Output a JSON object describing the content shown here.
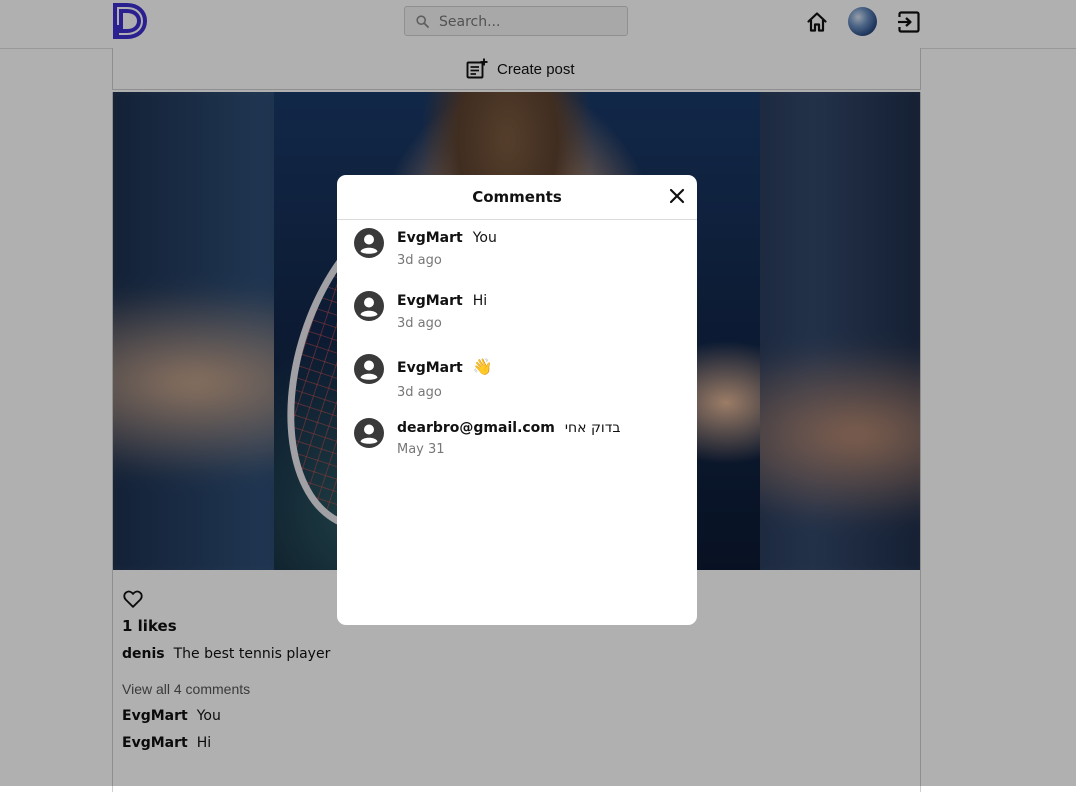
{
  "header": {
    "search_placeholder": "Search..."
  },
  "create_post": {
    "label": "Create post"
  },
  "post": {
    "likes": "1 likes",
    "author": "denis",
    "caption": "The best tennis player",
    "view_all": "View all 4 comments",
    "preview_comments": [
      {
        "user": "EvgMart",
        "text": "You"
      },
      {
        "user": "EvgMart",
        "text": "Hi"
      }
    ]
  },
  "modal": {
    "title": "Comments",
    "comments": [
      {
        "user": "EvgMart",
        "text": "You",
        "time": "3d ago"
      },
      {
        "user": "EvgMart",
        "text": "Hi",
        "time": "3d ago"
      },
      {
        "user": "EvgMart",
        "text": "👋",
        "time": "3d ago"
      },
      {
        "user": "dearbro@gmail.com",
        "text": "בדוק אחי",
        "time": "May 31"
      }
    ]
  },
  "colors": {
    "brand": "#3f2fd0",
    "overlay": "rgba(0,0,0,0.31)"
  },
  "icons": {
    "logo": "brand-logo-icon",
    "search": "search-icon",
    "home": "home-icon",
    "logout": "logout-icon",
    "create": "add-post-icon",
    "like": "heart-icon",
    "close": "close-icon",
    "avatar": "user-avatar-icon"
  }
}
